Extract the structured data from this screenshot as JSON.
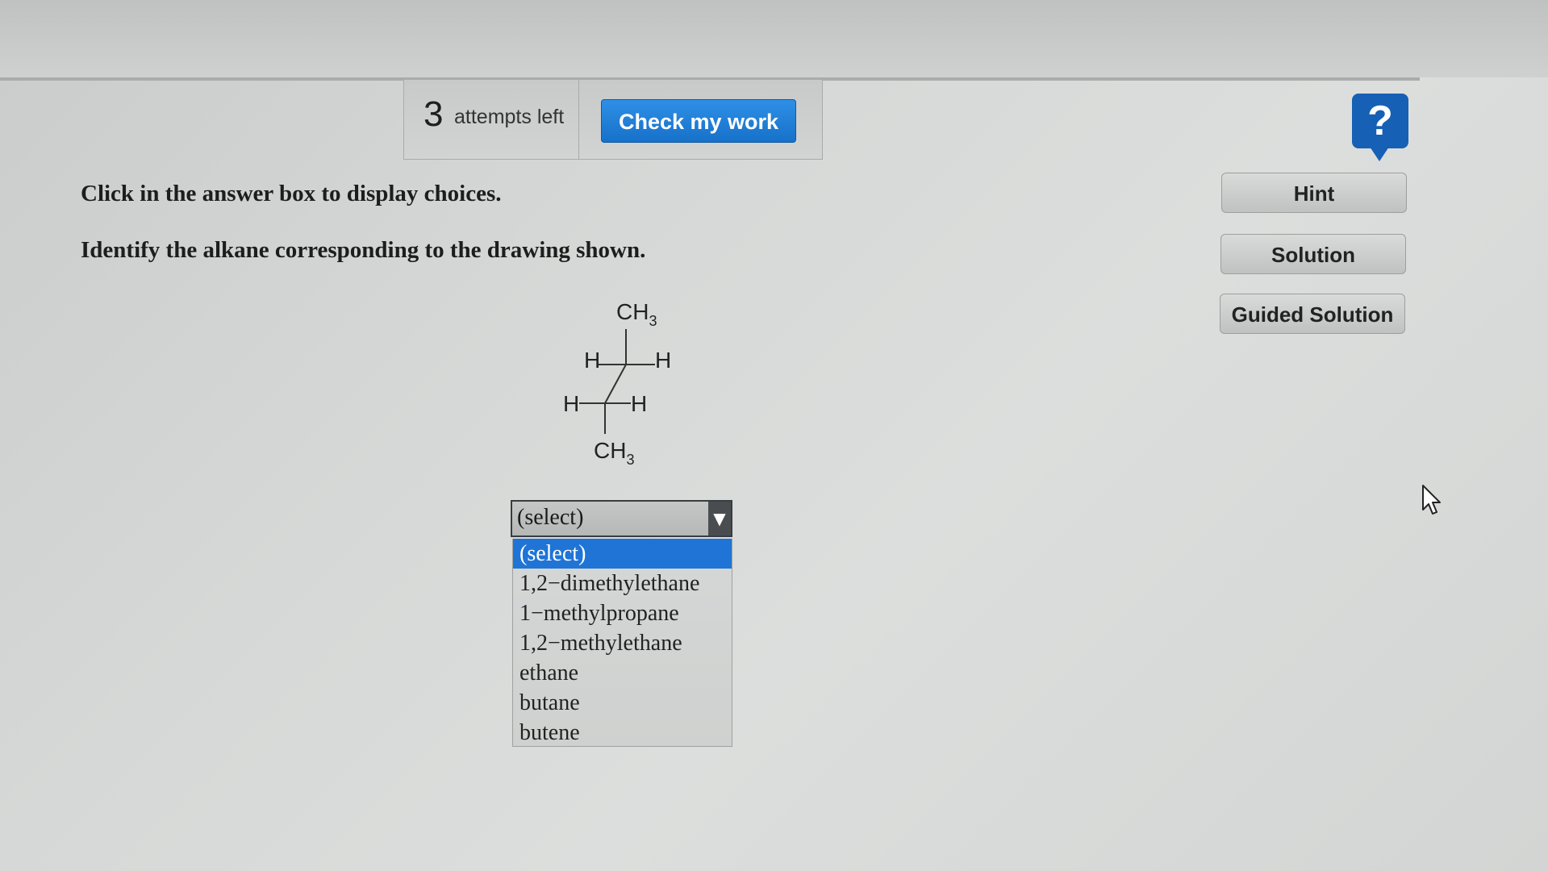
{
  "attempts": {
    "count": "3",
    "label": "attempts left"
  },
  "toolbar": {
    "check_label": "Check my work",
    "help_glyph": "?"
  },
  "instructions": {
    "click_prompt": "Click in the answer box to display choices.",
    "question": "Identify the alkane corresponding to the drawing shown."
  },
  "side_buttons": {
    "hint": "Hint",
    "solution": "Solution",
    "guided_solution": "Guided Solution"
  },
  "molecule": {
    "top_group": "CH",
    "top_subscript": "3",
    "bottom_group": "CH",
    "bottom_subscript": "3",
    "h_front_left": "H",
    "h_back_left": "H",
    "h_front_right": "H",
    "h_back_right": "H"
  },
  "answer_select": {
    "current_value": "(select)",
    "options": [
      "(select)",
      "1,2−dimethylethane",
      "1−methylpropane",
      "1,2−methylethane",
      "ethane",
      "butane",
      "butene"
    ],
    "selected_index": 0
  },
  "colors": {
    "accent": "#1671c9",
    "help_badge": "#1660b5",
    "selected_option": "#1f74d6"
  },
  "icons": {
    "help": "question-mark-icon",
    "dropdown": "triangle-down-icon",
    "cursor": "mouse-pointer-icon"
  }
}
